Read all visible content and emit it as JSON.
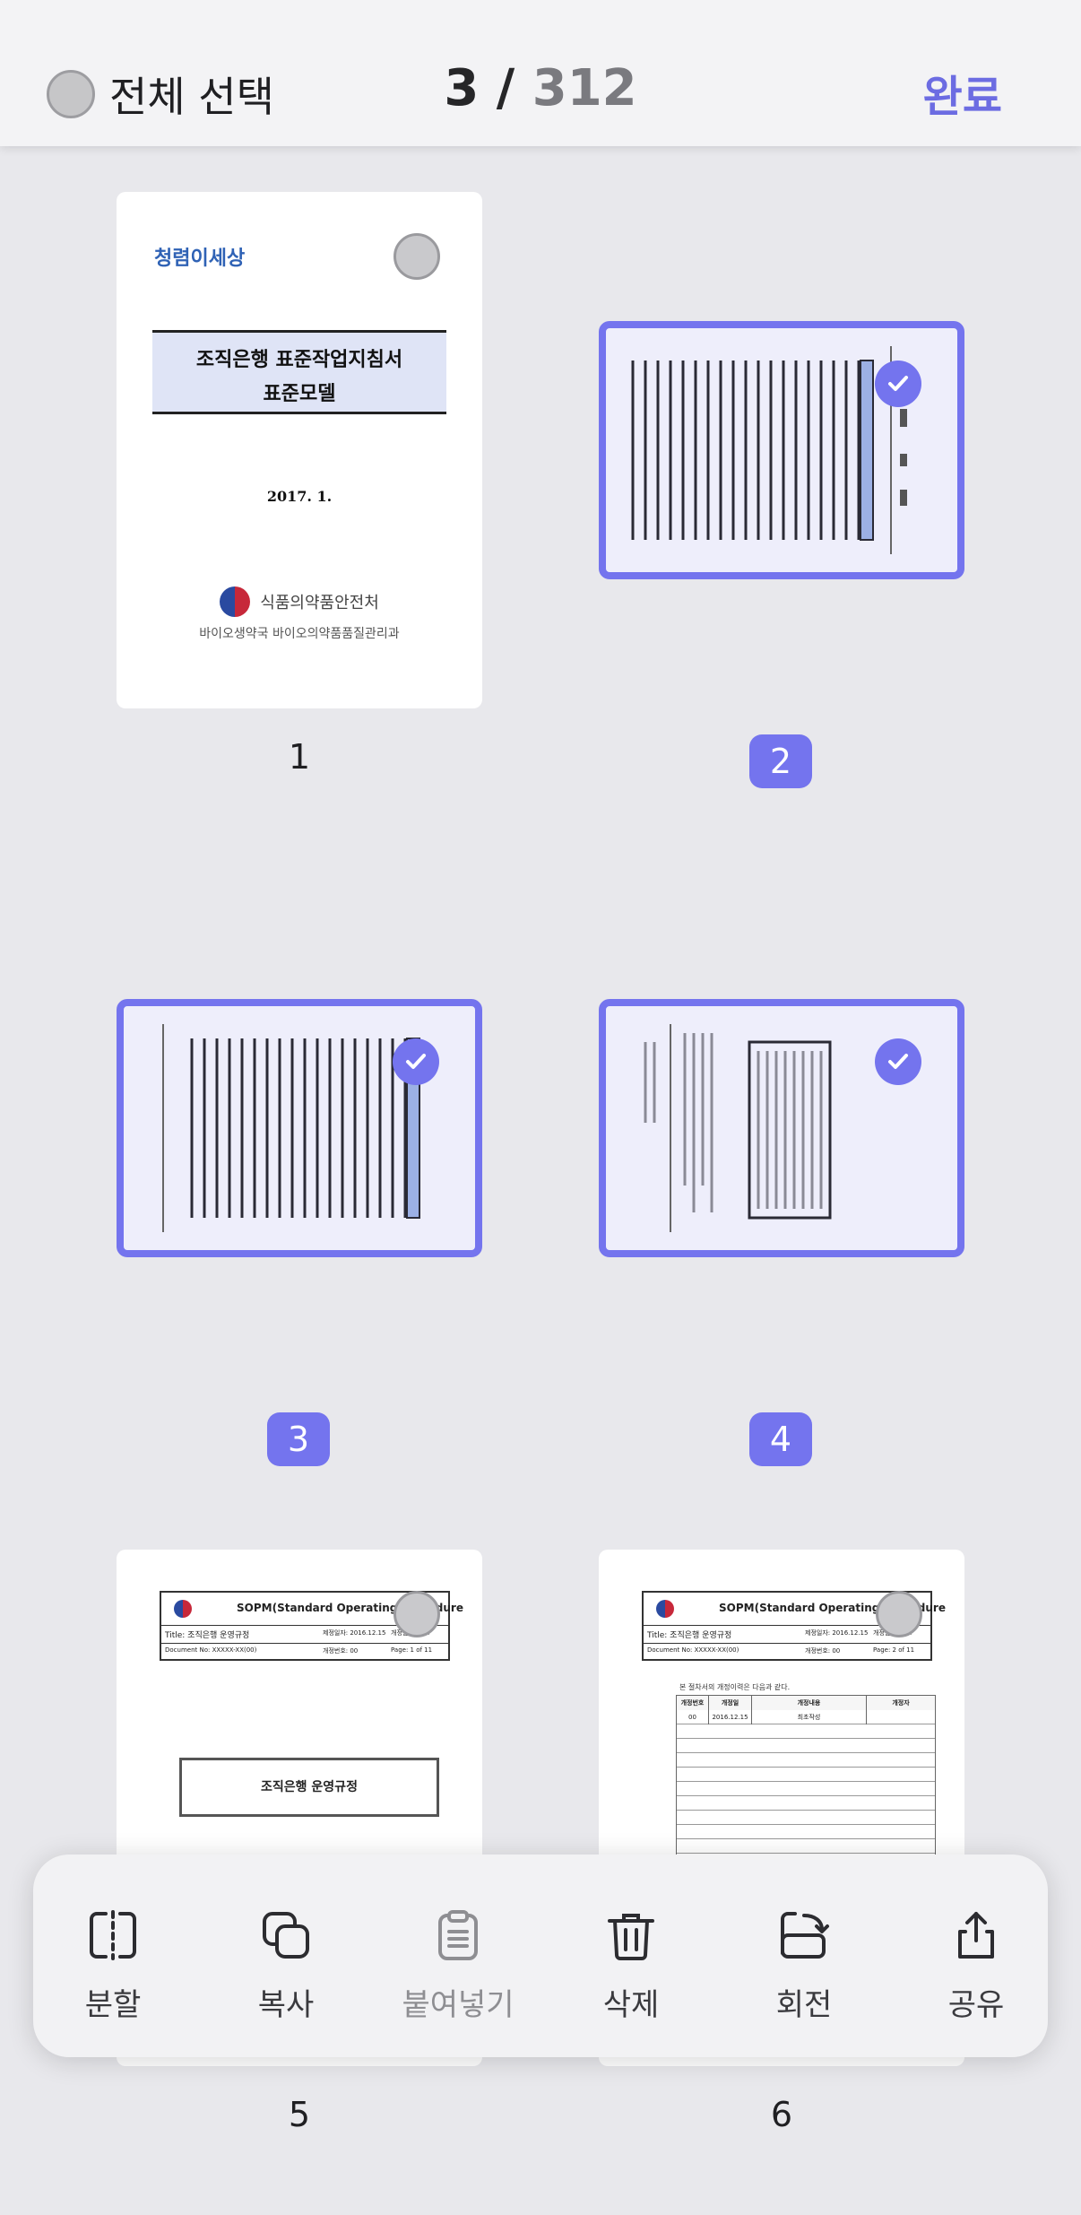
{
  "header": {
    "select_all_label": "전체 선택",
    "current": "3",
    "separator": "/",
    "total": "312",
    "done_label": "완료"
  },
  "pages": [
    {
      "number": "1",
      "selected": false,
      "doc": {
        "logo_text": "청렴이세상",
        "title_line1": "조직은행 표준작업지침서",
        "title_line2": "표준모델",
        "date": "2017. 1.",
        "org": "식품의약품안전처",
        "dept": "바이오생약국 바이오의약품품질관리과"
      }
    },
    {
      "number": "2",
      "selected": true
    },
    {
      "number": "3",
      "selected": true
    },
    {
      "number": "4",
      "selected": true
    },
    {
      "number": "5",
      "selected": false,
      "doc": {
        "header_title": "SOPM(Standard Operating Procedure",
        "row1_left": "Title: 조직은행 운영규정",
        "row1_mid": "제정일자: 2016.12.15",
        "row1_right": "개정일자: N/A",
        "row2_left": "Document No: XXXXX-XX(00)",
        "row2_mid": "개정번호: 00",
        "row2_right": "Page: 1 of 11",
        "box_title": "조직은행 운영규정"
      }
    },
    {
      "number": "6",
      "selected": false,
      "doc": {
        "header_title": "SOPM(Standard Operating Procedure",
        "row1_left": "Title: 조직은행 운영규정",
        "row1_mid": "제정일자: 2016.12.15",
        "row1_right": "개정일자: N/A",
        "row2_left": "Document No: XXXXX-XX(00)",
        "row2_mid": "개정번호: 00",
        "row2_right": "Page: 2 of 11",
        "note": "본 절차서의 개정이력은 다음과 같다.",
        "col1": "개정번호",
        "col2": "개정일",
        "col3": "개정내용",
        "col4": "개정자",
        "r1c1": "00",
        "r1c2": "2016.12.15",
        "r1c3": "최초작성"
      }
    }
  ],
  "toolbar": {
    "split": "분할",
    "copy": "복사",
    "paste": "붙여넣기",
    "delete": "삭제",
    "rotate": "회전",
    "share": "공유"
  },
  "colors": {
    "accent": "#7474ee",
    "done": "#6c6ce2",
    "background": "#e8e8ec"
  }
}
